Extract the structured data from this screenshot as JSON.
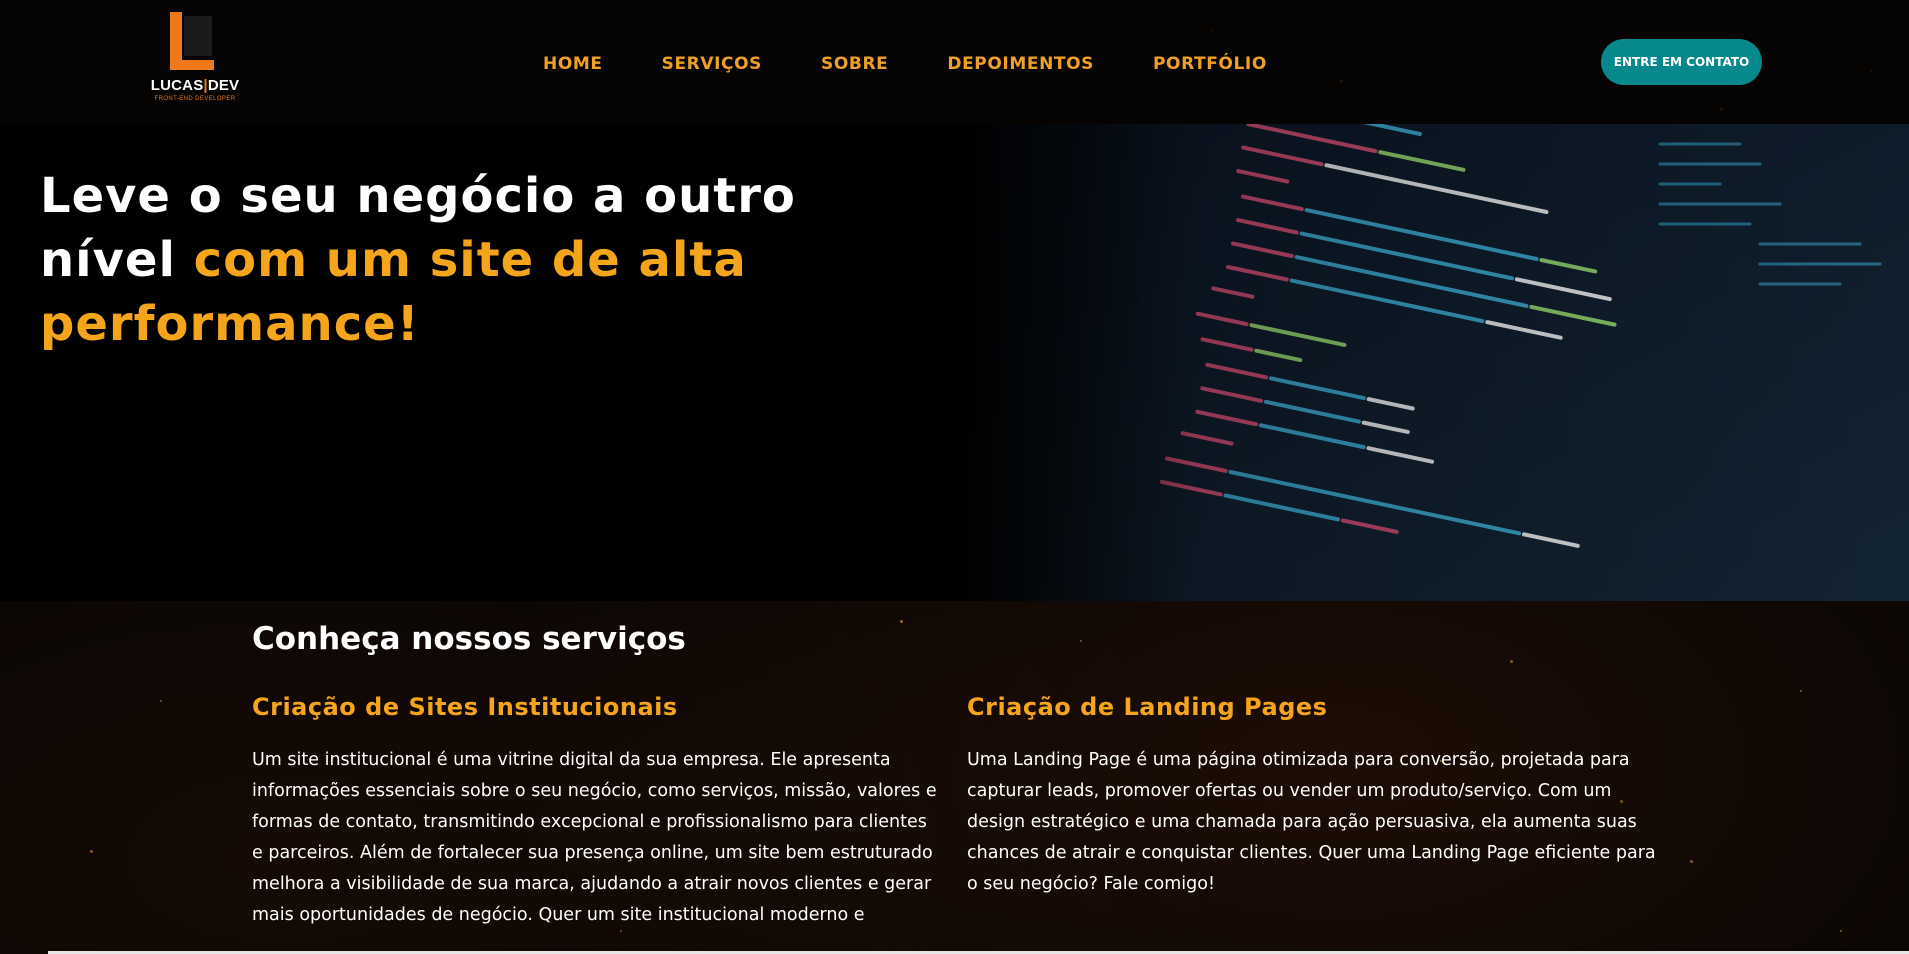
{
  "brand": {
    "name_left": "LUCAS",
    "name_right": "DEV",
    "tagline": "FRONT-END DEVELOPER",
    "colors": {
      "accent": "#f5a51c",
      "logo_orange": "#f07818",
      "cta": "#07888c",
      "background": "#050403"
    }
  },
  "nav": {
    "items": [
      {
        "label": "HOME"
      },
      {
        "label": "SERVIÇOS"
      },
      {
        "label": "SOBRE"
      },
      {
        "label": "DEPOIMENTOS"
      },
      {
        "label": "PORTFÓLIO"
      }
    ],
    "cta_label": "ENTRE EM CONTATO"
  },
  "hero": {
    "title_plain": "Leve o seu negócio a outro nível ",
    "title_accent": "com um site de alta performance!",
    "image": "code-editor-screenshot"
  },
  "services": {
    "heading": "Conheça nossos serviços",
    "items": [
      {
        "title": "Criação de Sites Institucionais",
        "text": "Um site institucional é uma vitrine digital da sua empresa. Ele apresenta informações essenciais sobre o seu negócio, como serviços, missão, valores e formas de contato, transmitindo excepcional e profissionalismo para clientes e parceiros. Além de fortalecer sua presença online, um site bem estruturado melhora a visibilidade de sua marca, ajudando a atrair novos clientes e gerar mais oportunidades de negócio. Quer um site institucional moderno e"
      },
      {
        "title": "Criação de Landing Pages",
        "text": "Uma Landing Page é uma página otimizada para conversão, projetada para capturar leads, promover ofertas ou vender um produto/serviço. Com um design estratégico e uma chamada para ação persuasiva, ela aumenta suas chances de atrair e conquistar clientes. Quer uma Landing Page eficiente para o seu negócio? Fale comigo!"
      }
    ]
  }
}
